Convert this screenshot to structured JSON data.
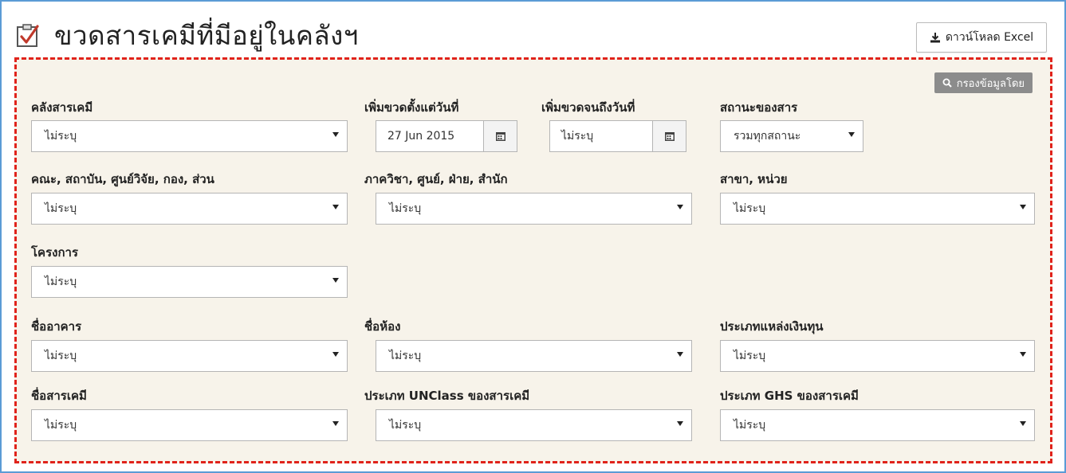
{
  "header": {
    "title": "ขวดสารเคมีที่มีอยู่ในคลังฯ",
    "download_label": "ดาวน์โหลด Excel"
  },
  "panel": {
    "filter_label": "กรองข้อมูลโดย",
    "fields": {
      "warehouse": {
        "label": "คลังสารเคมี",
        "value": "ไม่ระบุ"
      },
      "date_from": {
        "label": "เพิ่มขวดตั้งแต่วันที่",
        "value": "27 Jun 2015"
      },
      "date_to": {
        "label": "เพิ่มขวดจนถึงวันที่",
        "value": "ไม่ระบุ"
      },
      "status": {
        "label": "สถานะของสาร",
        "value": "รวมทุกสถานะ"
      },
      "faculty": {
        "label": "คณะ, สถาบัน, ศูนย์วิจัย, กอง, ส่วน",
        "value": "ไม่ระบุ"
      },
      "department": {
        "label": "ภาควิชา, ศูนย์, ฝ่าย, สำนัก",
        "value": "ไม่ระบุ"
      },
      "branch": {
        "label": "สาขา, หน่วย",
        "value": "ไม่ระบุ"
      },
      "project": {
        "label": "โครงการ",
        "value": "ไม่ระบุ"
      },
      "building": {
        "label": "ชื่ออาคาร",
        "value": "ไม่ระบุ"
      },
      "room": {
        "label": "ชื่อห้อง",
        "value": "ไม่ระบุ"
      },
      "funding": {
        "label": "ประเภทแหล่งเงินทุน",
        "value": "ไม่ระบุ"
      },
      "chemical_name": {
        "label": "ชื่อสารเคมี",
        "value": "ไม่ระบุ"
      },
      "unclass": {
        "label": "ประเภท UNClass ของสารเคมี",
        "value": "ไม่ระบุ"
      },
      "ghs": {
        "label": "ประเภท GHS ของสารเคมี",
        "value": "ไม่ระบุ"
      }
    }
  },
  "colors": {
    "panel_bg": "#f7f3ea",
    "dashed_border": "#e0231b",
    "frame_border": "#5b9bd5",
    "badge_bg": "#8c8c8c"
  }
}
